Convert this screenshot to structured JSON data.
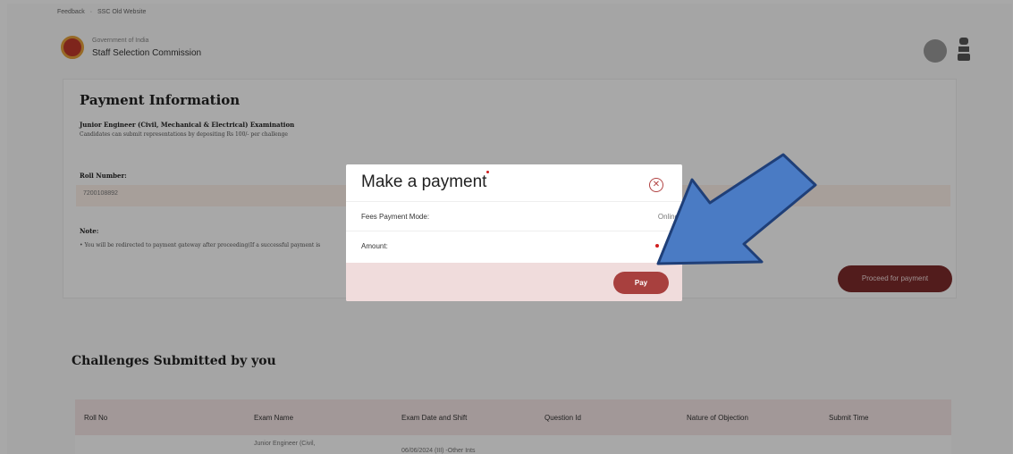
{
  "topbar": {
    "feedback": "Feedback",
    "old_website": "SSC Old Website"
  },
  "header": {
    "gov_label": "Government of India",
    "org_name": "Staff Selection Commission"
  },
  "payment_info": {
    "title": "Payment Information",
    "exam_name": "Junior Engineer (Civil, Mechanical & Electrical) Examination",
    "exam_sub": "Candidates can submit representations by depositing Rs 100/- per challenge",
    "roll_label": "Roll Number:",
    "roll_value": "7200108892",
    "note_label": "Note:",
    "note_item": "• You will be redirected to payment gateway after proceeding(If a successful payment is",
    "proceed_label": "Proceed for payment"
  },
  "challenges": {
    "title": "Challenges Submitted by you",
    "headers": [
      "Roll No",
      "Exam Name",
      "Exam Date and Shift",
      "Question Id",
      "Nature of Objection",
      "Submit Time"
    ],
    "first_row_exam": "Junior Engineer (Civil,",
    "first_row_date": "06/06/2024 (III) -Other Ints"
  },
  "modal": {
    "title": "Make a payment",
    "fees_label": "Fees Payment Mode:",
    "fees_value": "Online",
    "amount_label": "Amount:",
    "amount_value": "",
    "pay_label": "Pay"
  },
  "colors": {
    "accent": "#7d2b2b",
    "pay": "#a8403e",
    "arrow": "#4a7bc4"
  },
  "icons": {
    "close": "close-circle-icon",
    "arrow": "pointer-arrow-icon"
  }
}
